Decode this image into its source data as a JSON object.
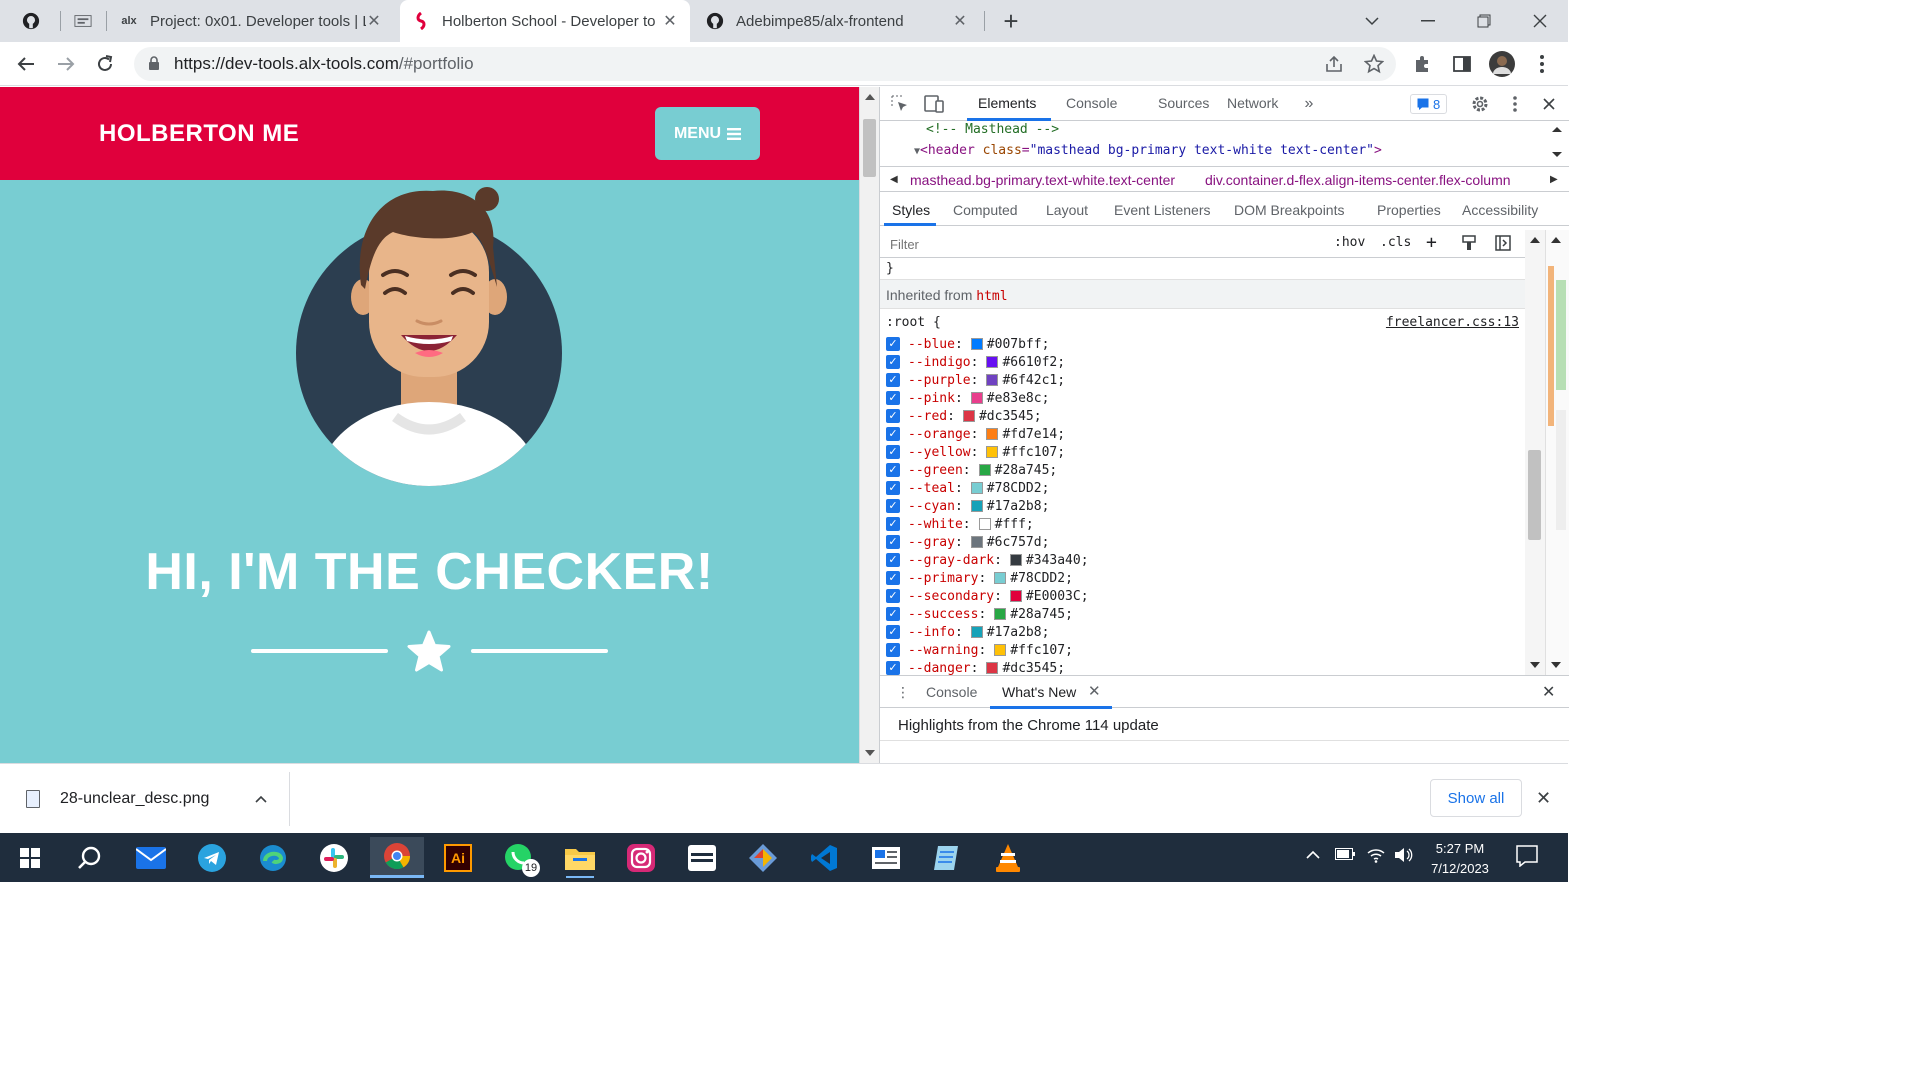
{
  "browser": {
    "tabs": [
      {
        "icon": "github-icon",
        "title": ""
      },
      {
        "icon": "school-icon",
        "title": ""
      },
      {
        "icon": "alx-icon",
        "favicon_text": "alx",
        "title": "Project: 0x01. Developer tools | L"
      },
      {
        "icon": "holberton-icon",
        "title": "Holberton School - Developer to"
      },
      {
        "icon": "github-icon",
        "title": "Adebimpe85/alx-frontend"
      }
    ],
    "url_host": "https://dev-tools.alx-tools.com",
    "url_path": "/#portfolio"
  },
  "page": {
    "brand": "HOLBERTON ME",
    "menu_label": "MENU",
    "hero_title": "HI, I'M THE CHECKER!",
    "colors": {
      "primary": "#78CDD2",
      "secondary": "#E0003C"
    }
  },
  "devtools": {
    "tabs": [
      "Elements",
      "Console",
      "Sources",
      "Network"
    ],
    "issues_count": "8",
    "dom": {
      "comment": "<!-- Masthead -->",
      "tag_open": "<header",
      "attr_name": "class",
      "attr_value": "\"masthead bg-primary text-white text-center\"",
      "tag_close": ">"
    },
    "breadcrumbs": [
      "masthead.bg-primary.text-white.text-center",
      "div.container.d-flex.align-items-center.flex-column"
    ],
    "subtabs": [
      "Styles",
      "Computed",
      "Layout",
      "Event Listeners",
      "DOM Breakpoints",
      "Properties",
      "Accessibility"
    ],
    "filter_placeholder": "Filter",
    "tools": [
      ":hov",
      ".cls"
    ],
    "close_brace": "}",
    "inherited_label": "Inherited from",
    "inherited_element": "html",
    "selector": ":root {",
    "source": "freelancer.css:13",
    "properties": [
      {
        "name": "--blue",
        "value": "#007bff;",
        "color": "#007bff"
      },
      {
        "name": "--indigo",
        "value": "#6610f2;",
        "color": "#6610f2"
      },
      {
        "name": "--purple",
        "value": "#6f42c1;",
        "color": "#6f42c1"
      },
      {
        "name": "--pink",
        "value": "#e83e8c;",
        "color": "#e83e8c"
      },
      {
        "name": "--red",
        "value": "#dc3545;",
        "color": "#dc3545"
      },
      {
        "name": "--orange",
        "value": "#fd7e14;",
        "color": "#fd7e14"
      },
      {
        "name": "--yellow",
        "value": "#ffc107;",
        "color": "#ffc107"
      },
      {
        "name": "--green",
        "value": "#28a745;",
        "color": "#28a745"
      },
      {
        "name": "--teal",
        "value": "#78CDD2;",
        "color": "#78CDD2"
      },
      {
        "name": "--cyan",
        "value": "#17a2b8;",
        "color": "#17a2b8"
      },
      {
        "name": "--white",
        "value": "#fff;",
        "color": "#ffffff"
      },
      {
        "name": "--gray",
        "value": "#6c757d;",
        "color": "#6c757d"
      },
      {
        "name": "--gray-dark",
        "value": "#343a40;",
        "color": "#343a40"
      },
      {
        "name": "--primary",
        "value": "#78CDD2;",
        "color": "#78CDD2"
      },
      {
        "name": "--secondary",
        "value": "#E0003C;",
        "color": "#E0003C"
      },
      {
        "name": "--success",
        "value": "#28a745;",
        "color": "#28a745"
      },
      {
        "name": "--info",
        "value": "#17a2b8;",
        "color": "#17a2b8"
      },
      {
        "name": "--warning",
        "value": "#ffc107;",
        "color": "#ffc107"
      },
      {
        "name": "--danger",
        "value": "#dc3545;",
        "color": "#dc3545"
      }
    ],
    "drawer_tabs": [
      "Console",
      "What's New"
    ],
    "drawer_text": "Highlights from the Chrome 114 update"
  },
  "download": {
    "filename": "28-unclear_desc.png",
    "show_all": "Show all"
  },
  "taskbar": {
    "apps": [
      "start",
      "search",
      "mail",
      "telegram",
      "edge",
      "slack",
      "chrome",
      "illustrator",
      "whatsapp",
      "file-explorer",
      "instagram",
      "terminal",
      "git",
      "vscode",
      "news",
      "notepad",
      "vlc"
    ],
    "illustrator_label": "Ai",
    "whatsapp_badge": "19",
    "time": "5:27 PM",
    "date": "7/12/2023"
  }
}
